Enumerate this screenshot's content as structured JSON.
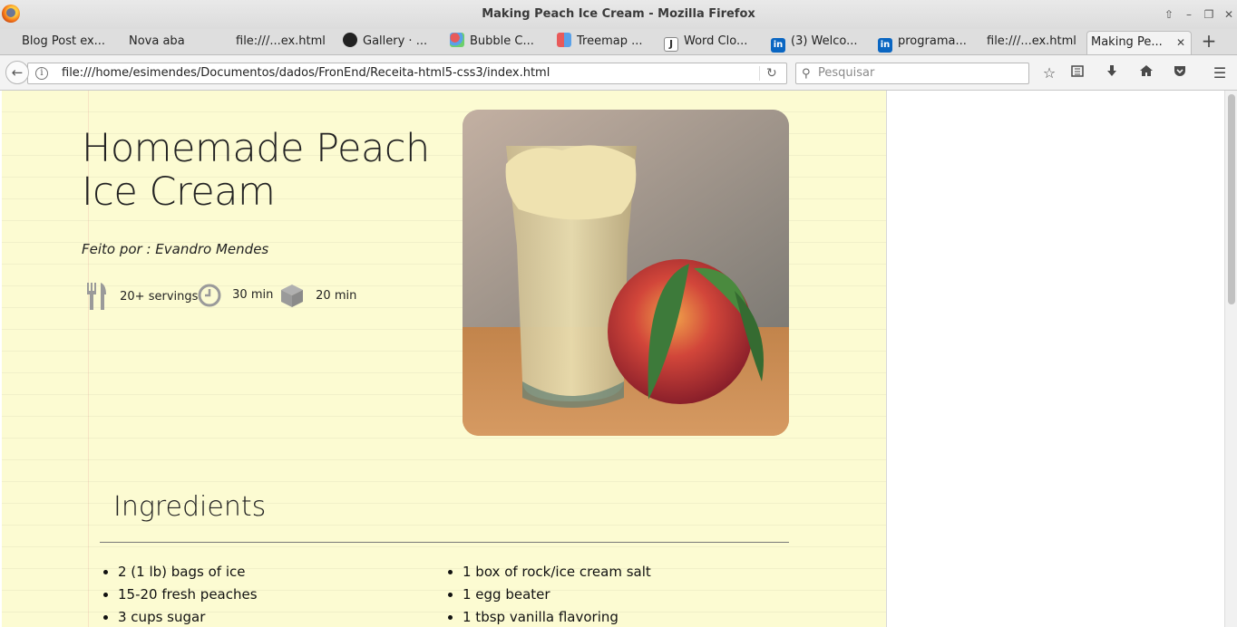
{
  "window": {
    "title": "Making Peach Ice Cream - Mozilla Firefox"
  },
  "tabs": [
    {
      "label": "Blog Post ex...",
      "icon": "blank-icon"
    },
    {
      "label": "Nova aba",
      "icon": "blank-icon"
    },
    {
      "label": "file:///...ex.html",
      "icon": "blank-icon"
    },
    {
      "label": "Gallery · ...",
      "icon": "github-icon"
    },
    {
      "label": "Bubble C...",
      "icon": "bubble-chart-icon"
    },
    {
      "label": "Treemap ...",
      "icon": "treemap-icon"
    },
    {
      "label": "Word Clo...",
      "icon": "j-icon"
    },
    {
      "label": "(3) Welco...",
      "icon": "linkedin-icon"
    },
    {
      "label": "programa...",
      "icon": "linkedin-icon"
    },
    {
      "label": "file:///...ex.html",
      "icon": "blank-icon"
    },
    {
      "label": "Making Pe...",
      "icon": "blank-icon",
      "active": true
    }
  ],
  "navbar": {
    "url": "file:///home/esimendes/Documentos/dados/FronEnd/Receita-html5-css3/index.html",
    "search_placeholder": "Pesquisar"
  },
  "recipe": {
    "title": "Homemade Peach Ice Cream",
    "author": "Feito por : Evandro Mendes",
    "servings": "20+ servings",
    "prep_time": "30 min",
    "cook_time": "20 min",
    "ingredients_heading": "Ingredients",
    "ingredients_left": [
      "2 (1 lb) bags of ice",
      "15-20 fresh peaches",
      "3 cups sugar"
    ],
    "ingredients_right": [
      "1 box of rock/ice cream salt",
      "1 egg beater",
      "1 tbsp vanilla flavoring"
    ]
  },
  "colors": {
    "page_background": "#fcfbd2",
    "icon_gray": "#9a9a9a"
  }
}
